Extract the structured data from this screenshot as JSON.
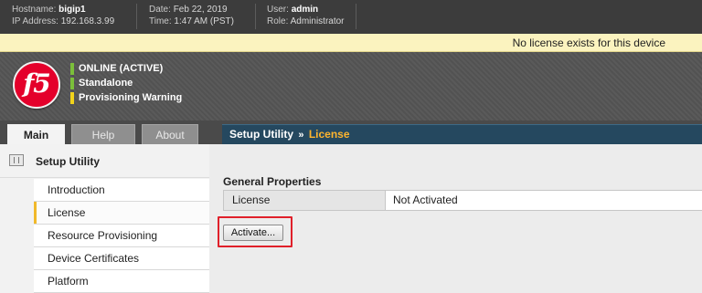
{
  "topbar": {
    "hostname_label": "Hostname:",
    "hostname": "bigip1",
    "ip_label": "IP Address:",
    "ip": "192.168.3.99",
    "date_label": "Date:",
    "date": "Feb 22, 2019",
    "time_label": "Time:",
    "time": "1:47 AM (PST)",
    "user_label": "User:",
    "user": "admin",
    "role_label": "Role:",
    "role": "Administrator"
  },
  "license_bar": {
    "message": "No license exists for this device"
  },
  "logo": {
    "text": "f5",
    "color": "#e4002b"
  },
  "status": [
    {
      "label": "ONLINE (ACTIVE)",
      "color": "#7bbf3a"
    },
    {
      "label": "Standalone",
      "color": "#7bbf3a"
    },
    {
      "label": "Provisioning Warning",
      "color": "#f2d31b"
    }
  ],
  "tabs": [
    {
      "label": "Main",
      "active": true
    },
    {
      "label": "Help",
      "active": false
    },
    {
      "label": "About",
      "active": false
    }
  ],
  "page_title": {
    "parent": "Setup Utility",
    "separator": "»",
    "current": "License"
  },
  "nav": {
    "heading": "Setup Utility",
    "heading_icon": "setup-utility-icon",
    "items": [
      {
        "label": "Introduction",
        "selected": false
      },
      {
        "label": "License",
        "selected": true
      },
      {
        "label": "Resource Provisioning",
        "selected": false
      },
      {
        "label": "Device Certificates",
        "selected": false
      },
      {
        "label": "Platform",
        "selected": false
      }
    ]
  },
  "main": {
    "section_title": "General Properties",
    "rows": [
      {
        "label": "License",
        "value": "Not Activated"
      }
    ],
    "activate_label": "Activate...",
    "highlight_color": "#e0202a"
  },
  "colors": {
    "accent": "#f1b92a",
    "title_bar": "#25485f",
    "title_current": "#ffb52e"
  }
}
